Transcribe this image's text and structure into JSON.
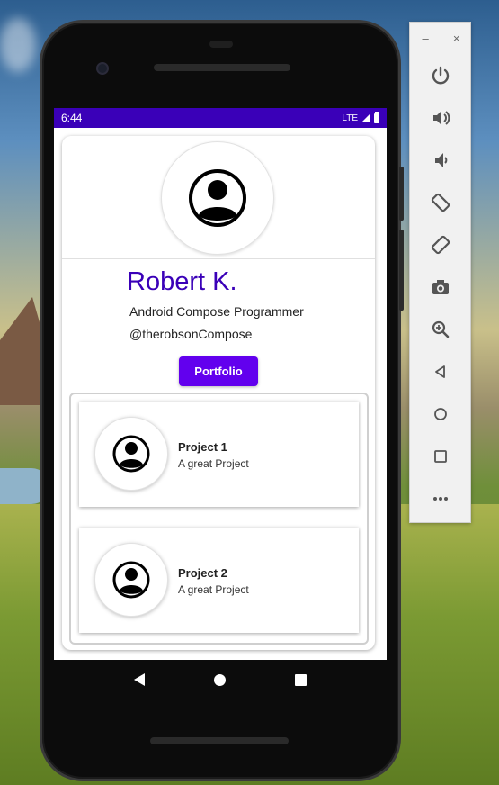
{
  "status_bar": {
    "time": "6:44",
    "network": "LTE"
  },
  "profile": {
    "name": "Robert K.",
    "title": "Android Compose Programmer",
    "handle": "@therobsonCompose",
    "portfolio_button": "Portfolio"
  },
  "projects": [
    {
      "name": "Project 1",
      "description": "A great Project"
    },
    {
      "name": "Project 2",
      "description": "A great Project"
    }
  ],
  "emulator": {
    "window_controls": [
      "–",
      "×"
    ],
    "buttons": [
      "power-icon",
      "volume-up-icon",
      "volume-down-icon",
      "rotate-left-icon",
      "rotate-right-icon",
      "camera-icon",
      "zoom-icon",
      "back-icon",
      "home-icon",
      "overview-icon",
      "more-icon"
    ]
  },
  "colors": {
    "status_bar": "#3a00b8",
    "name_text": "#3a00b8",
    "button_bg": "#6200ee"
  }
}
